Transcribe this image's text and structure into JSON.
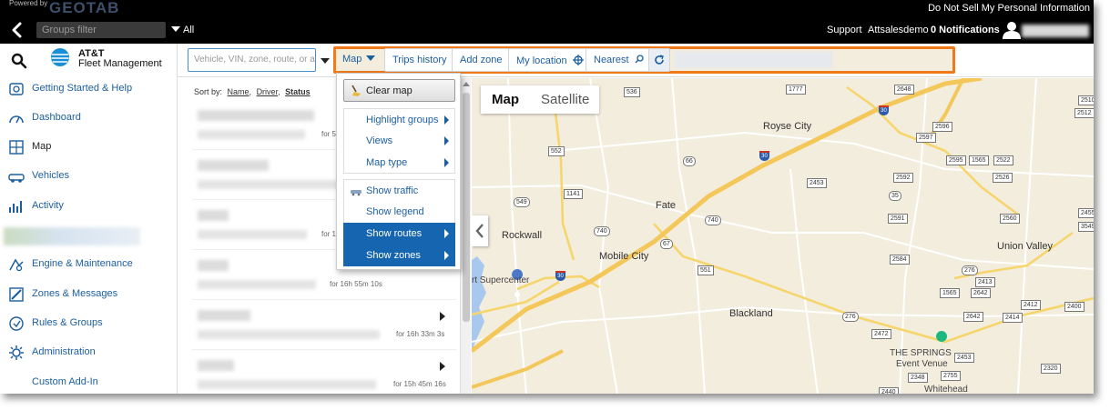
{
  "topbar": {
    "powered_by": "Powered by",
    "brand": "GEOTAB",
    "do_not_sell": "Do Not Sell My Personal Information",
    "groups_filter_placeholder": "Groups filter",
    "all_label": "All",
    "support": "Support",
    "account": "Attsalesdemo",
    "notifications": "0 Notifications"
  },
  "sidebar": {
    "brand_line1": "AT&T",
    "brand_line2": "Fleet Management",
    "items": [
      {
        "label": "Getting Started & Help",
        "icon": "help-icon"
      },
      {
        "label": "Dashboard",
        "icon": "dashboard-icon"
      },
      {
        "label": "Map",
        "icon": "map-icon"
      },
      {
        "label": "Vehicles",
        "icon": "vehicle-icon"
      },
      {
        "label": "Activity",
        "icon": "activity-icon"
      },
      {
        "label": "Engine & Maintenance",
        "icon": "engine-icon"
      },
      {
        "label": "Zones & Messages",
        "icon": "zones-icon"
      },
      {
        "label": "Rules & Groups",
        "icon": "rules-icon"
      },
      {
        "label": "Administration",
        "icon": "admin-icon"
      },
      {
        "label": "Custom Add-In",
        "icon": ""
      }
    ]
  },
  "toolbar": {
    "search_placeholder": "Vehicle, VIN, zone, route, or a",
    "map_button": "Map",
    "trips_history": "Trips history",
    "add_zone": "Add zone",
    "my_location": "My location",
    "nearest": "Nearest"
  },
  "list": {
    "sort_by": "Sort by:",
    "sort_name": "Name",
    "sort_driver": "Driver",
    "sort_status": "Status",
    "rows": [
      {
        "time": "for 5"
      },
      {
        "time": ""
      },
      {
        "time": "for 1"
      },
      {
        "time": "for 16h 55m 10s"
      },
      {
        "time": "for 16h 33m 3s"
      },
      {
        "time": "for 15h 45m 16s"
      }
    ]
  },
  "map_menu": {
    "clear_map": "Clear map",
    "highlight_groups": "Highlight groups",
    "views": "Views",
    "map_type": "Map type",
    "show_traffic": "Show traffic",
    "show_legend": "Show legend",
    "show_routes": "Show routes",
    "show_zones": "Show zones"
  },
  "map": {
    "type_map": "Map",
    "type_satellite": "Satellite",
    "cities": [
      "Royse City",
      "Fate",
      "Rockwall",
      "Mobile City",
      "Blackland",
      "Union Valley"
    ],
    "poi": [
      "rt Supercenter",
      "THE SPRINGS",
      "Event Venue",
      "Whitehead"
    ],
    "shields": [
      "536",
      "1777",
      "2648",
      "2510",
      "2512",
      "552",
      "66",
      "2596",
      "2597",
      "2595",
      "1565",
      "2522",
      "2526",
      "2592",
      "2453",
      "1141",
      "35",
      "549",
      "2591",
      "2560",
      "2455",
      "740",
      "67",
      "3549",
      "551",
      "2584",
      "276",
      "1565",
      "2642",
      "2413",
      "2412",
      "2400",
      "2414",
      "276",
      "2642",
      "2320",
      "2440",
      "2472",
      "2453",
      "2348",
      "2755",
      "740",
      "30",
      "30",
      "30"
    ]
  },
  "colors": {
    "accent_orange": "#f07a1a",
    "link_blue": "#1b5e9e",
    "menu_blue": "#1565b0",
    "map_bg": "#f3edde",
    "highway": "#f4c75a",
    "water": "#a9c8ee"
  }
}
